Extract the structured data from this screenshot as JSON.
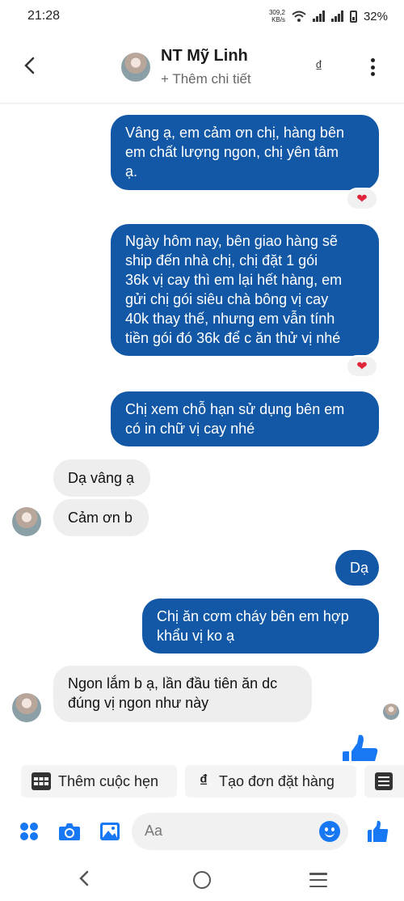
{
  "status_bar": {
    "time": "21:28",
    "speed_value": "309,2",
    "speed_unit": "KB/s",
    "battery": "32%"
  },
  "header": {
    "name": "NT Mỹ Linh",
    "add_details": "+ Thêm chi tiết",
    "currency_symbol": "₫"
  },
  "messages": [
    {
      "side": "out",
      "lines": [
        "Vâng ạ, em cảm ơn chị, hàng bên",
        "em chất lượng ngon, chị yên tâm",
        "ạ."
      ],
      "reaction": "heart"
    },
    {
      "side": "out",
      "lines": [
        "Ngày hôm nay, bên giao hàng sẽ",
        "ship đến nhà chị, chị đặt 1 gói",
        "36k vị cay thì em lại hết hàng, em",
        "gửi chị gói siêu chà bông vị cay",
        "40k thay thế, nhưng em vẫn tính",
        "tiền gói đó 36k để c ăn thử vị nhé"
      ],
      "reaction": "heart"
    },
    {
      "side": "out",
      "lines": [
        "Chị xem chỗ hạn sử dụng bên em",
        "có in chữ vị cay nhé"
      ]
    },
    {
      "side": "in",
      "lines": [
        "Dạ vâng ạ"
      ]
    },
    {
      "side": "in",
      "lines": [
        "Cảm ơn b"
      ]
    },
    {
      "side": "out",
      "lines": [
        "Dạ"
      ]
    },
    {
      "side": "out",
      "lines": [
        "Chị ăn cơm cháy bên em hợp",
        "khẩu vị ko ạ"
      ]
    },
    {
      "side": "in",
      "lines": [
        "Ngon lắm b ạ, lần đầu tiên ăn dc",
        "đúng vị ngon như này"
      ]
    }
  ],
  "quick_actions": [
    {
      "label": "Thêm cuộc hẹn",
      "icon": "calendar-icon"
    },
    {
      "label": "Tạo đơn đặt hàng",
      "icon": "dong-icon"
    },
    {
      "label": "",
      "icon": "list-icon"
    }
  ],
  "composer": {
    "placeholder": "Aa"
  },
  "colors": {
    "outgoing_bubble": "#1258a6",
    "incoming_bubble": "#eeeeee",
    "accent": "#1877f2",
    "heart": "#e0253a"
  }
}
